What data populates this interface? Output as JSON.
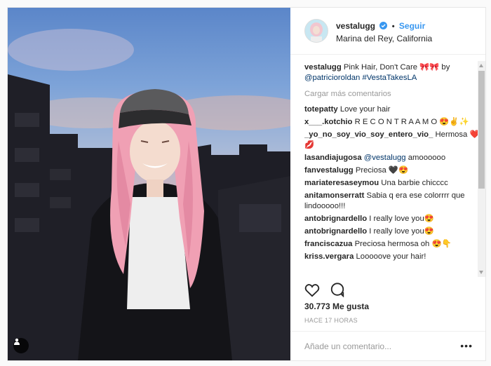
{
  "post": {
    "username": "vestalugg",
    "separator": "•",
    "follow_label": "Seguir",
    "location": "Marina del Rey, California"
  },
  "caption": {
    "username": "vestalugg",
    "text": " Pink Hair, Don't Care 🎀🎀 by ",
    "mention": "@patricioroldan",
    "hashtag": "#VestaTakesLA"
  },
  "load_more_label": "Cargar más comentarios",
  "comments": [
    {
      "user": "totepatty",
      "text": " Love your hair"
    },
    {
      "user": "x___.kotchio",
      "text": " R E C O N T R A A M O 😍✌️✨"
    },
    {
      "user": "_yo_no_soy_vio_soy_entero_vio_",
      "text": " Hermosa ❤️💋"
    },
    {
      "user": "lasandiajugosa",
      "mention": " @vestalugg",
      "text": " amoooooo"
    },
    {
      "user": "fanvestalugg",
      "text": " Preciosa 🖤😍"
    },
    {
      "user": "mariateresaseymou",
      "text": " Una barbie chicccc"
    },
    {
      "user": "anitamonserratt",
      "text": " Sabia q era ese colorrrr que lindooooo!!!"
    },
    {
      "user": "antobrignardello",
      "text": " I really love you😍"
    },
    {
      "user": "antobrignardello",
      "text": " I really love you😍"
    },
    {
      "user": "franciscazua",
      "text": " Preciosa hermosa oh 😍👇"
    },
    {
      "user": "kriss.vergara",
      "text": " Looooove your hair!"
    }
  ],
  "likes_label": "30.773 Me gusta",
  "time_label": "HACE 17 HORAS",
  "comment_placeholder": "Añade un comentario...",
  "more_options": "•••",
  "icons": {
    "like": "heart-icon",
    "comment": "comment-icon",
    "verified": "verified-badge-icon",
    "user_tag": "user-tag-icon"
  },
  "colors": {
    "link": "#003569",
    "follow": "#3897f0",
    "muted": "#999999",
    "verified": "#3897f0"
  }
}
